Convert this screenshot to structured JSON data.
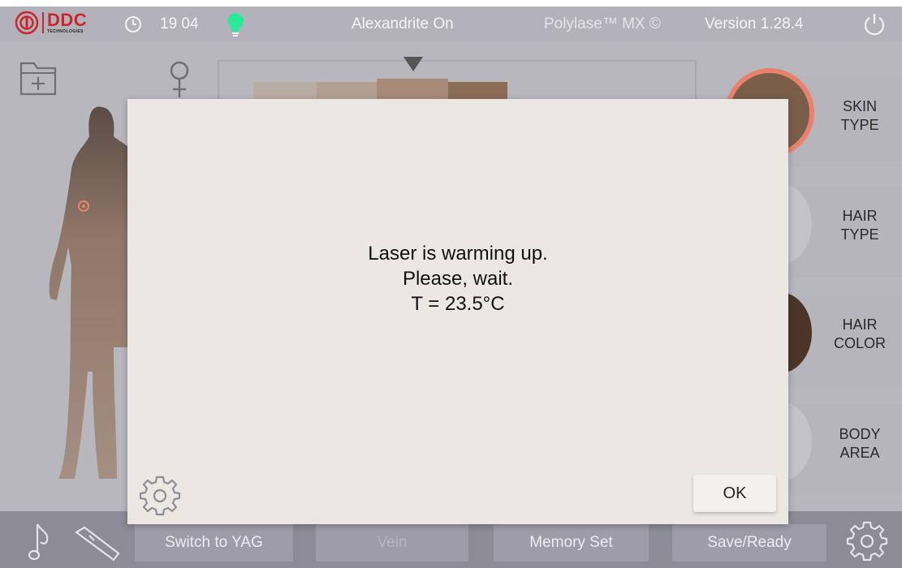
{
  "header": {
    "brand_name": "DDC",
    "brand_sub": "TECHNOLOGIES",
    "time": "19 04",
    "laser_status": "Alexandrite On",
    "product": "Polylase™ MX ©",
    "version": "Version 1.28.4",
    "status_light_color": "#2ee89a"
  },
  "side_menu": {
    "items": [
      {
        "label_line1": "SKIN",
        "label_line2": "TYPE"
      },
      {
        "label_line1": "HAIR",
        "label_line2": "TYPE"
      },
      {
        "label_line1": "HAIR",
        "label_line2": "COLOR"
      },
      {
        "label_line1": "BODY",
        "label_line2": "AREA"
      }
    ]
  },
  "bottom_bar": {
    "switch_label": "Switch to YAG",
    "vein_label": "Vein",
    "memory_label": "Memory Set",
    "save_label": "Save/Ready"
  },
  "modal": {
    "line1": "Laser is warming up.",
    "line2": "Please, wait.",
    "line3": "T = 23.5°C",
    "ok_label": "OK"
  },
  "icons": [
    "clock-icon",
    "bulb-icon",
    "power-icon",
    "folder-add-icon",
    "female-icon",
    "music-note-icon",
    "handpiece-icon",
    "gear-icon"
  ],
  "colors": {
    "brand_red": "#c8272b",
    "accent_ring": "#e8826d"
  }
}
